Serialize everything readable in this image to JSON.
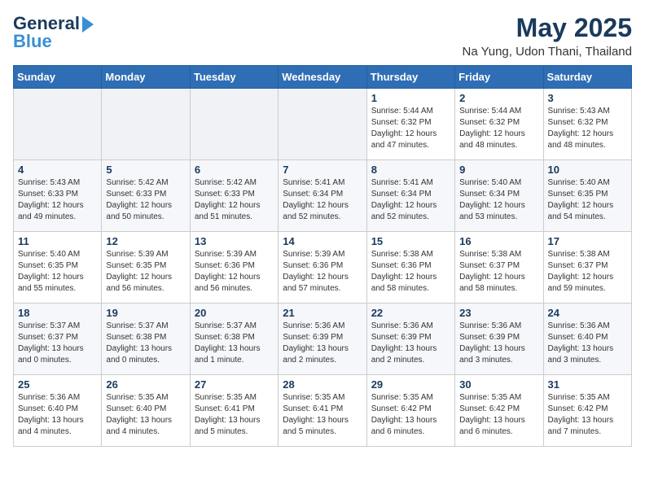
{
  "logo": {
    "general": "General",
    "blue": "Blue"
  },
  "header": {
    "month": "May 2025",
    "location": "Na Yung, Udon Thani, Thailand"
  },
  "weekdays": [
    "Sunday",
    "Monday",
    "Tuesday",
    "Wednesday",
    "Thursday",
    "Friday",
    "Saturday"
  ],
  "weeks": [
    [
      {
        "day": "",
        "sunrise": "",
        "sunset": "",
        "daylight": ""
      },
      {
        "day": "",
        "sunrise": "",
        "sunset": "",
        "daylight": ""
      },
      {
        "day": "",
        "sunrise": "",
        "sunset": "",
        "daylight": ""
      },
      {
        "day": "",
        "sunrise": "",
        "sunset": "",
        "daylight": ""
      },
      {
        "day": "1",
        "sunrise": "Sunrise: 5:44 AM",
        "sunset": "Sunset: 6:32 PM",
        "daylight": "Daylight: 12 hours and 47 minutes."
      },
      {
        "day": "2",
        "sunrise": "Sunrise: 5:44 AM",
        "sunset": "Sunset: 6:32 PM",
        "daylight": "Daylight: 12 hours and 48 minutes."
      },
      {
        "day": "3",
        "sunrise": "Sunrise: 5:43 AM",
        "sunset": "Sunset: 6:32 PM",
        "daylight": "Daylight: 12 hours and 48 minutes."
      }
    ],
    [
      {
        "day": "4",
        "sunrise": "Sunrise: 5:43 AM",
        "sunset": "Sunset: 6:33 PM",
        "daylight": "Daylight: 12 hours and 49 minutes."
      },
      {
        "day": "5",
        "sunrise": "Sunrise: 5:42 AM",
        "sunset": "Sunset: 6:33 PM",
        "daylight": "Daylight: 12 hours and 50 minutes."
      },
      {
        "day": "6",
        "sunrise": "Sunrise: 5:42 AM",
        "sunset": "Sunset: 6:33 PM",
        "daylight": "Daylight: 12 hours and 51 minutes."
      },
      {
        "day": "7",
        "sunrise": "Sunrise: 5:41 AM",
        "sunset": "Sunset: 6:34 PM",
        "daylight": "Daylight: 12 hours and 52 minutes."
      },
      {
        "day": "8",
        "sunrise": "Sunrise: 5:41 AM",
        "sunset": "Sunset: 6:34 PM",
        "daylight": "Daylight: 12 hours and 52 minutes."
      },
      {
        "day": "9",
        "sunrise": "Sunrise: 5:40 AM",
        "sunset": "Sunset: 6:34 PM",
        "daylight": "Daylight: 12 hours and 53 minutes."
      },
      {
        "day": "10",
        "sunrise": "Sunrise: 5:40 AM",
        "sunset": "Sunset: 6:35 PM",
        "daylight": "Daylight: 12 hours and 54 minutes."
      }
    ],
    [
      {
        "day": "11",
        "sunrise": "Sunrise: 5:40 AM",
        "sunset": "Sunset: 6:35 PM",
        "daylight": "Daylight: 12 hours and 55 minutes."
      },
      {
        "day": "12",
        "sunrise": "Sunrise: 5:39 AM",
        "sunset": "Sunset: 6:35 PM",
        "daylight": "Daylight: 12 hours and 56 minutes."
      },
      {
        "day": "13",
        "sunrise": "Sunrise: 5:39 AM",
        "sunset": "Sunset: 6:36 PM",
        "daylight": "Daylight: 12 hours and 56 minutes."
      },
      {
        "day": "14",
        "sunrise": "Sunrise: 5:39 AM",
        "sunset": "Sunset: 6:36 PM",
        "daylight": "Daylight: 12 hours and 57 minutes."
      },
      {
        "day": "15",
        "sunrise": "Sunrise: 5:38 AM",
        "sunset": "Sunset: 6:36 PM",
        "daylight": "Daylight: 12 hours and 58 minutes."
      },
      {
        "day": "16",
        "sunrise": "Sunrise: 5:38 AM",
        "sunset": "Sunset: 6:37 PM",
        "daylight": "Daylight: 12 hours and 58 minutes."
      },
      {
        "day": "17",
        "sunrise": "Sunrise: 5:38 AM",
        "sunset": "Sunset: 6:37 PM",
        "daylight": "Daylight: 12 hours and 59 minutes."
      }
    ],
    [
      {
        "day": "18",
        "sunrise": "Sunrise: 5:37 AM",
        "sunset": "Sunset: 6:37 PM",
        "daylight": "Daylight: 13 hours and 0 minutes."
      },
      {
        "day": "19",
        "sunrise": "Sunrise: 5:37 AM",
        "sunset": "Sunset: 6:38 PM",
        "daylight": "Daylight: 13 hours and 0 minutes."
      },
      {
        "day": "20",
        "sunrise": "Sunrise: 5:37 AM",
        "sunset": "Sunset: 6:38 PM",
        "daylight": "Daylight: 13 hours and 1 minute."
      },
      {
        "day": "21",
        "sunrise": "Sunrise: 5:36 AM",
        "sunset": "Sunset: 6:39 PM",
        "daylight": "Daylight: 13 hours and 2 minutes."
      },
      {
        "day": "22",
        "sunrise": "Sunrise: 5:36 AM",
        "sunset": "Sunset: 6:39 PM",
        "daylight": "Daylight: 13 hours and 2 minutes."
      },
      {
        "day": "23",
        "sunrise": "Sunrise: 5:36 AM",
        "sunset": "Sunset: 6:39 PM",
        "daylight": "Daylight: 13 hours and 3 minutes."
      },
      {
        "day": "24",
        "sunrise": "Sunrise: 5:36 AM",
        "sunset": "Sunset: 6:40 PM",
        "daylight": "Daylight: 13 hours and 3 minutes."
      }
    ],
    [
      {
        "day": "25",
        "sunrise": "Sunrise: 5:36 AM",
        "sunset": "Sunset: 6:40 PM",
        "daylight": "Daylight: 13 hours and 4 minutes."
      },
      {
        "day": "26",
        "sunrise": "Sunrise: 5:35 AM",
        "sunset": "Sunset: 6:40 PM",
        "daylight": "Daylight: 13 hours and 4 minutes."
      },
      {
        "day": "27",
        "sunrise": "Sunrise: 5:35 AM",
        "sunset": "Sunset: 6:41 PM",
        "daylight": "Daylight: 13 hours and 5 minutes."
      },
      {
        "day": "28",
        "sunrise": "Sunrise: 5:35 AM",
        "sunset": "Sunset: 6:41 PM",
        "daylight": "Daylight: 13 hours and 5 minutes."
      },
      {
        "day": "29",
        "sunrise": "Sunrise: 5:35 AM",
        "sunset": "Sunset: 6:42 PM",
        "daylight": "Daylight: 13 hours and 6 minutes."
      },
      {
        "day": "30",
        "sunrise": "Sunrise: 5:35 AM",
        "sunset": "Sunset: 6:42 PM",
        "daylight": "Daylight: 13 hours and 6 minutes."
      },
      {
        "day": "31",
        "sunrise": "Sunrise: 5:35 AM",
        "sunset": "Sunset: 6:42 PM",
        "daylight": "Daylight: 13 hours and 7 minutes."
      }
    ]
  ]
}
